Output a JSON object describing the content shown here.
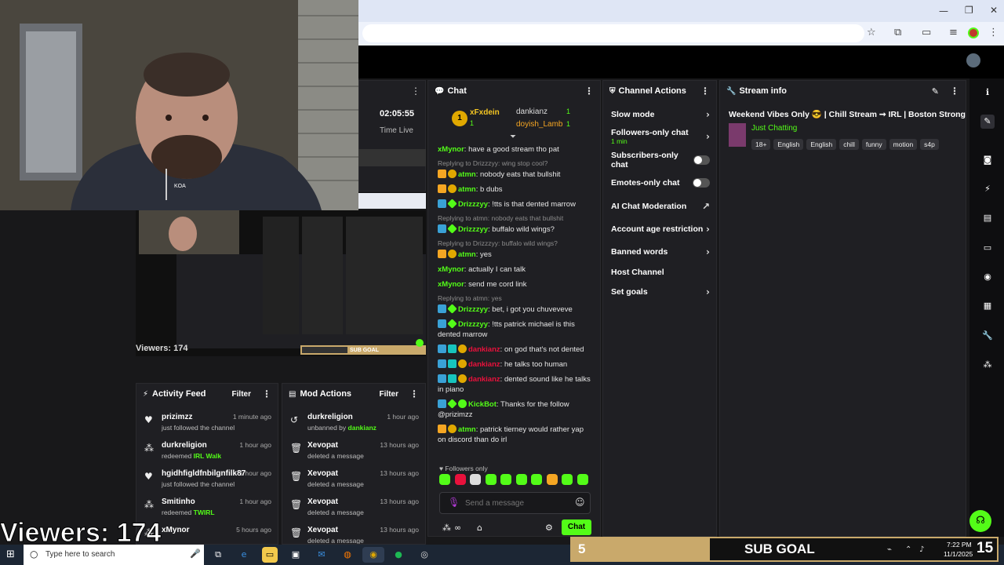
{
  "browser": {
    "minimize": "—",
    "restore": "❐",
    "close": "✕"
  },
  "webcam": {
    "viewers_label": "Viewers: 174",
    "shirt_logo": "KOA"
  },
  "preview": {
    "viewers_label": "Viewers: 174",
    "sub_goal": "SUB GOAL"
  },
  "stream_time": {
    "time": "02:05:55",
    "label": "Time Live"
  },
  "chat": {
    "title": "Chat",
    "leaders": [
      {
        "rank": "1",
        "name": "xFxdein",
        "count": "1"
      },
      {
        "name": "dankianz",
        "count": "1"
      },
      {
        "name": "doyish_Lamb",
        "count": "1"
      }
    ],
    "messages": [
      {
        "reply": "",
        "user": "xMynor",
        "color": "#53fc18",
        "badges": [],
        "text": "have a good stream tho pat"
      },
      {
        "reply": "Replying to Drizzzyy: wing stop cool?",
        "user": "atmn",
        "color": "#53fc18",
        "badges": [
          "crown",
          "gold"
        ],
        "text": "nobody eats that bullshit"
      },
      {
        "reply": "",
        "user": "atmn",
        "color": "#53fc18",
        "badges": [
          "crown",
          "gold"
        ],
        "text": "b dubs"
      },
      {
        "reply": "",
        "user": "Drizzzyy",
        "color": "#53fc18",
        "badges": [
          "blue",
          "green"
        ],
        "text": "!tts is that dented marrow"
      },
      {
        "reply": "Replying to atmn: nobody eats that bullshit",
        "user": "Drizzzyy",
        "color": "#53fc18",
        "badges": [
          "blue",
          "green"
        ],
        "text": "buffalo wild wings?"
      },
      {
        "reply": "Replying to Drizzzyy: buffalo wild wings?",
        "user": "atmn",
        "color": "#53fc18",
        "badges": [
          "crown",
          "gold"
        ],
        "text": "yes"
      },
      {
        "reply": "",
        "user": "xMynor",
        "color": "#53fc18",
        "badges": [],
        "text": "actually I can talk"
      },
      {
        "reply": "",
        "user": "xMynor",
        "color": "#53fc18",
        "badges": [],
        "text": "send me cord link"
      },
      {
        "reply": "Replying to atmn: yes",
        "user": "Drizzzyy",
        "color": "#53fc18",
        "badges": [
          "blue",
          "green"
        ],
        "text": "bet, i got you chuveveve"
      },
      {
        "reply": "",
        "user": "Drizzzyy",
        "color": "#53fc18",
        "badges": [
          "blue",
          "green"
        ],
        "text": "!tts patrick michael is this dented marrow"
      },
      {
        "reply": "",
        "user": "dankianz",
        "color": "#e9113c",
        "badges": [
          "blue",
          "cyan",
          "gold"
        ],
        "text": "on god that's not dented"
      },
      {
        "reply": "",
        "user": "dankianz",
        "color": "#e9113c",
        "badges": [
          "blue",
          "cyan",
          "gold"
        ],
        "text": "he talks too human"
      },
      {
        "reply": "",
        "user": "dankianz",
        "color": "#e9113c",
        "badges": [
          "blue",
          "cyan",
          "gold"
        ],
        "text": "dented sound like he talks in piano"
      },
      {
        "reply": "",
        "user": "KickBot",
        "color": "#53fc18",
        "badges": [
          "blue",
          "green",
          "bot"
        ],
        "text": "Thanks for the follow @prizimzz"
      },
      {
        "reply": "",
        "user": "atmn",
        "color": "#53fc18",
        "badges": [
          "crown",
          "gold"
        ],
        "text": "patrick tierney would rather yap on discord than do irl"
      }
    ],
    "followers_only": "Followers only",
    "input_placeholder": "Send a message",
    "send_label": "Chat"
  },
  "channel_actions": {
    "title": "Channel Actions",
    "items": [
      {
        "label": "Slow mode",
        "sub": "",
        "control": "chevron"
      },
      {
        "label": "Followers-only chat",
        "sub": "1 min",
        "control": "chevron"
      },
      {
        "label": "Subscribers-only chat",
        "sub": "",
        "control": "toggle"
      },
      {
        "label": "Emotes-only chat",
        "sub": "",
        "control": "toggle"
      },
      {
        "label": "AI Chat Moderation",
        "sub": "",
        "control": "external"
      },
      {
        "label": "Account age restriction",
        "sub": "",
        "control": "chevron"
      },
      {
        "label": "Banned words",
        "sub": "",
        "control": "chevron"
      },
      {
        "label": "Host Channel",
        "sub": "",
        "control": "none"
      },
      {
        "label": "Set goals",
        "sub": "",
        "control": "chevron"
      }
    ]
  },
  "stream_info": {
    "title": "Stream info",
    "stream_title": "Weekend Vibes Only 😎 | Chill Stream ➞ IRL | Boston Strong",
    "category": "Just Chatting",
    "tags": [
      "18+",
      "English",
      "English",
      "chill",
      "funny",
      "motion",
      "s4p"
    ]
  },
  "activity_feed": {
    "title": "Activity Feed",
    "filter": "Filter",
    "items": [
      {
        "icon": "heart",
        "name": "prizimzz",
        "sub": "just followed the channel",
        "extra": "",
        "time": "1 minute ago"
      },
      {
        "icon": "redeem",
        "name": "durkreligion",
        "sub": "redeemed ",
        "extra": "IRL Walk",
        "time": "1 hour ago"
      },
      {
        "icon": "heart",
        "name": "hgidhfigldfnbilgnfilk87",
        "sub": "just followed the channel",
        "extra": "",
        "time": "1 hour ago"
      },
      {
        "icon": "redeem",
        "name": "Smitinho",
        "sub": "redeemed ",
        "extra": "TWIRL",
        "time": "1 hour ago"
      },
      {
        "icon": "redeem",
        "name": "xMynor",
        "sub": "",
        "extra": "",
        "time": "5 hours ago"
      }
    ]
  },
  "mod_actions": {
    "title": "Mod Actions",
    "filter": "Filter",
    "items": [
      {
        "icon": "undo",
        "name": "durkreligion",
        "sub": "unbanned by ",
        "extra": "dankianz",
        "time": "1 hour ago"
      },
      {
        "icon": "trash",
        "name": "Xevopat",
        "sub": "deleted a message",
        "extra": "",
        "time": "13 hours ago"
      },
      {
        "icon": "trash",
        "name": "Xevopat",
        "sub": "deleted a message",
        "extra": "",
        "time": "13 hours ago"
      },
      {
        "icon": "trash",
        "name": "Xevopat",
        "sub": "deleted a message",
        "extra": "",
        "time": "13 hours ago"
      },
      {
        "icon": "trash",
        "name": "Xevopat",
        "sub": "deleted a message",
        "extra": "",
        "time": "13 hours ago"
      }
    ]
  },
  "sub_goal": {
    "count": "5",
    "label": "SUB GOAL",
    "day": "15"
  },
  "taskbar": {
    "search_placeholder": "Type here to search",
    "time": "7:22 PM",
    "date": "11/1/2025"
  },
  "colors": {
    "kick_green": "#53fc18",
    "panel": "#1f1f23",
    "danger": "#e9113c"
  }
}
